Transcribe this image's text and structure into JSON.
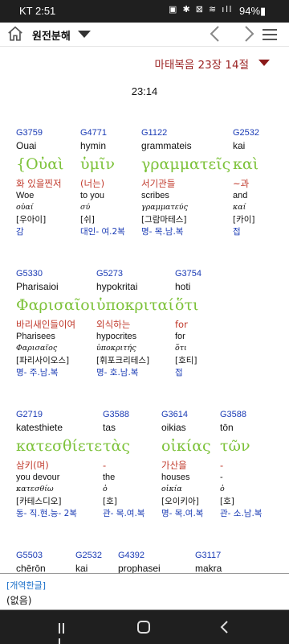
{
  "status": {
    "carrier": "KT 2:51",
    "icons": "▣ ✱ ⊠ ≋ ıll",
    "battery": "94%▮"
  },
  "appbar": {
    "book_select": "원전분해"
  },
  "reference": {
    "label": "마태복음 23장 14절"
  },
  "verse": {
    "label": "23:14"
  },
  "words": [
    {
      "strong": "G3759",
      "translit": "Ouai",
      "greek": "{Οὐαὶ",
      "korean": "화 있을찐저",
      "english": "Woe",
      "lemma": "οὐαί",
      "pron": "[우아이]",
      "parse": "감"
    },
    {
      "strong": "G4771",
      "translit": "hymin",
      "greek": "ὑμῖν",
      "korean": "(너는)",
      "english": "to you",
      "lemma": "σύ",
      "pron": "[쉬]",
      "parse": "대인- 여.2복"
    },
    {
      "strong": "G1122",
      "translit": "grammateis",
      "greek": "γραμματεῖς",
      "korean": "서기관들",
      "english": "scribes",
      "lemma": "γραμματεύς",
      "pron": "[그람마테스]",
      "parse": "명- 목.남.복"
    },
    {
      "strong": "G2532",
      "translit": "kai",
      "greek": "καὶ",
      "korean": "~과",
      "english": "and",
      "lemma": "καί",
      "pron": "[카이]",
      "parse": "접"
    },
    {
      "strong": "G5330",
      "translit": "Pharisaioi",
      "greek": "Φαρισαῖοι",
      "korean": "바리새인들이여",
      "english": "Pharisees",
      "lemma": "Φαρισαῖος",
      "pron": "[파리사이오스]",
      "parse": "명- 주.남.복"
    },
    {
      "strong": "G5273",
      "translit": "hypokritai",
      "greek": "ὑποκριταί",
      "korean": "외식하는",
      "english": "hypocrites",
      "lemma": "ὑποκριτής",
      "pron": "[휘포크리테스]",
      "parse": "명- 호.남.복"
    },
    {
      "strong": "G3754",
      "translit": "hoti",
      "greek": "ὅτι",
      "korean": "for",
      "english": "for",
      "lemma": "ὅτι",
      "pron": "[호티]",
      "parse": "접"
    },
    {
      "strong": "G2719",
      "translit": "katesthiete",
      "greek": "κατεσθίετε",
      "korean": "삼키(며)",
      "english": "you devour",
      "lemma": "κατεσθίω",
      "pron": "[카테스디오]",
      "parse": "동- 직.현.능- 2복"
    },
    {
      "strong": "G3588",
      "translit": "tas",
      "greek": "τὰς",
      "korean": "-",
      "english": "the",
      "lemma": "ὁ",
      "pron": "[호]",
      "parse": "관- 목.여.복"
    },
    {
      "strong": "G3614",
      "translit": "oikias",
      "greek": "οἰκίας",
      "korean": "가산을",
      "english": "houses",
      "lemma": "οἰκία",
      "pron": "[오이키아]",
      "parse": "명- 목.여.복"
    },
    {
      "strong": "G3588",
      "translit": "tōn",
      "greek": "τῶν",
      "korean": "-",
      "english": "-",
      "lemma": "ὁ",
      "pron": "[호]",
      "parse": "관- 소.남.복"
    },
    {
      "strong": "G5503",
      "translit": "chērōn",
      "greek": "",
      "korean": "",
      "english": "",
      "lemma": "",
      "pron": "",
      "parse": ""
    },
    {
      "strong": "G2532",
      "translit": "kai",
      "greek": "",
      "korean": "",
      "english": "",
      "lemma": "",
      "pron": "",
      "parse": ""
    },
    {
      "strong": "G4392",
      "translit": "prophasei",
      "greek": "",
      "korean": "",
      "english": "",
      "lemma": "",
      "pron": "",
      "parse": ""
    },
    {
      "strong": "G3117",
      "translit": "makra",
      "greek": "",
      "korean": "",
      "english": "",
      "lemma": "",
      "pron": "",
      "parse": ""
    }
  ],
  "bottom_panel": {
    "title": "[개역한글]",
    "text": "(없음)"
  },
  "icons": {
    "home": "home-icon",
    "dropdown": "chevron-down-icon",
    "prev": "chevron-left-icon",
    "next": "chevron-right-icon",
    "menu": "hamburger-menu-icon"
  },
  "colors": {
    "reference": "#9b2323",
    "strong": "#1a3bb5",
    "greek": "#7dc23a",
    "korean": "#c0392b"
  }
}
